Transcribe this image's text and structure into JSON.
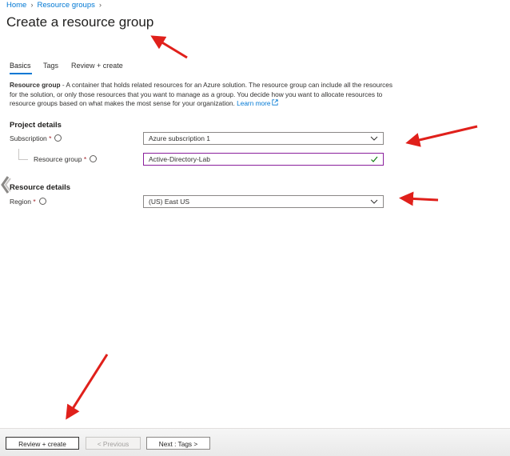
{
  "breadcrumb": {
    "items": [
      "Home",
      "Resource groups"
    ]
  },
  "page": {
    "title": "Create a resource group"
  },
  "tabs": [
    {
      "label": "Basics",
      "active": true
    },
    {
      "label": "Tags",
      "active": false
    },
    {
      "label": "Review + create",
      "active": false
    }
  ],
  "description": {
    "bold": "Resource group",
    "text": " - A container that holds related resources for an Azure solution. The resource group can include all the resources for the solution, or only those resources that you want to manage as a group. You decide how you want to allocate resources to resource groups based on what makes the most sense for your organization. ",
    "link": "Learn more"
  },
  "project_details": {
    "heading": "Project details",
    "subscription": {
      "label": "Subscription",
      "required": "*",
      "value": "Azure subscription 1"
    },
    "resource_group": {
      "label": "Resource group",
      "required": "*",
      "value": "Active-Directory-Lab"
    }
  },
  "resource_details": {
    "heading": "Resource details",
    "region": {
      "label": "Region",
      "required": "*",
      "value": "(US) East US"
    }
  },
  "footer": {
    "review_create": "Review + create",
    "previous": "< Previous",
    "next": "Next : Tags >"
  },
  "colors": {
    "accent": "#0078d4",
    "annotation_arrow": "#e0201b",
    "required": "#a4262c"
  }
}
